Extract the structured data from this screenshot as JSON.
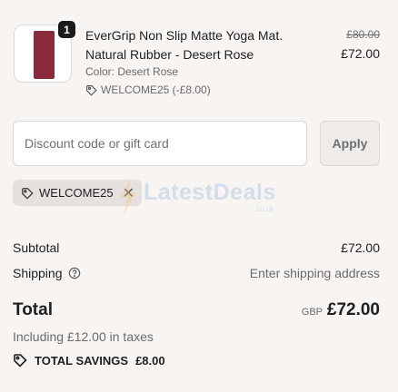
{
  "product": {
    "quantity": "1",
    "name": "EverGrip Non Slip Matte Yoga Mat. Natural Rubber - Desert Rose",
    "variant": "Color: Desert Rose",
    "discount_applied": "WELCOME25 (-£8.00)",
    "original_price": "£80.00",
    "price": "£72.00",
    "thumbnail_color": "#8a2a3a"
  },
  "discount": {
    "placeholder": "Discount code or gift card",
    "apply_label": "Apply",
    "applied_code": "WELCOME25"
  },
  "watermark": {
    "brand": "LatestDeals",
    "sub": ".co.uk"
  },
  "summary": {
    "subtotal_label": "Subtotal",
    "subtotal_value": "£72.00",
    "shipping_label": "Shipping",
    "shipping_value": "Enter shipping address",
    "total_label": "Total",
    "currency": "GBP",
    "total_value": "£72.00",
    "tax_note": "Including £12.00 in taxes",
    "savings_label": "TOTAL SAVINGS",
    "savings_value": "£8.00"
  }
}
